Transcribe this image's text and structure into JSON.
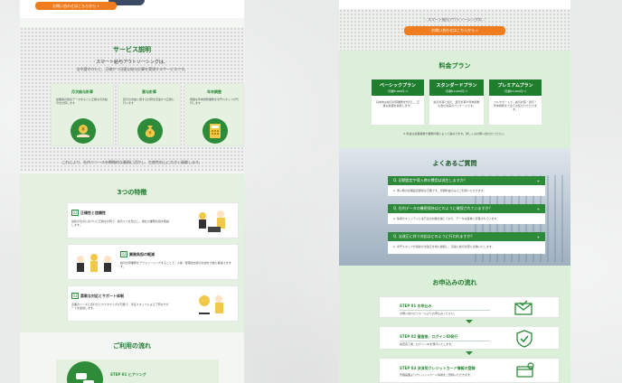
{
  "left": {
    "cta_label": "お問い合わせはこちらから »",
    "service": {
      "title": "サービス説明",
      "lead1": "スマート給与アウトソーシングは、",
      "lead2": "法令遵守のもと、正確かつ迅速な給与計算を実現するサービスです。",
      "cards": [
        {
          "title": "月次給与計算",
          "text": "従業員の勤怠データをもとに正確な月次給与を計算します"
        },
        {
          "title": "賞与計算",
          "text": "賞与の支給に関する計算を迅速かつ正確に行います"
        },
        {
          "title": "年末調整",
          "text": "煩雑な年末調整業務を専門スタッフが代行します"
        }
      ],
      "note": "これにより、社内リソースを戦略的な業務に活かし、生産性向上に大きく貢献します。"
    },
    "features": {
      "title": "3つの特徴",
      "items": [
        {
          "num": "01",
          "title": "正確性と信頼性",
          "text": "最新の法令に基づいた正確な計算で、給与ミスを防止し、貴社の業務負担を軽減します。"
        },
        {
          "num": "02",
          "title": "業務負担の軽減",
          "text": "給与計算業務をアウトソーシングすることで、人事・経理担当者の負担を大幅に軽減できます。"
        },
        {
          "num": "03",
          "title": "柔軟な対応とサポート体制",
          "text": "企業のニーズに合わせたカスタマイズが可能で、専任スタッフによる丁寧なサポートを提供します。"
        }
      ]
    },
    "flow": {
      "title": "ご利用の流れ",
      "step1": "STEP 01  ヒアリング"
    }
  },
  "right": {
    "cta_caption": "＼ スマート給与アウトソーシングの ／",
    "cta_label": "お問い合わせはこちらから »",
    "pricing": {
      "title": "料金プラン",
      "plans": [
        {
          "name": "ベーシックプラン",
          "price": "（月額5,000円〜）",
          "text": "基本的な給与計算業務を代行し、正確な処理を提供します。"
        },
        {
          "name": "スタンダードプラン",
          "price": "（月額10,000円〜）",
          "text": "給与計算に加え、賞与計算や年末調整も含む充実のパッケージです。"
        },
        {
          "name": "プレミアムプラン",
          "price": "（月額15,000円〜）",
          "text": "フルサポートで、給与計算・賞与・年末調整まで全てお任せいただけます。"
        }
      ],
      "note": "※ 料金は従業員数や業務内容によって異なります。詳しくはお問い合わせください。"
    },
    "faq": {
      "title": "よくあるご質問",
      "items": [
        {
          "q": "Q.  初期設定や導入時の費用は発生しますか？",
          "a": "A.  導入時の初期設定費用は不要です。月額料金のみでご利用いただけます。"
        },
        {
          "q": "Q.  社内データの機密保持はどのように確保されていますか？",
          "a": "A.  情報セキュリティには万全の対策を講じており、データは厳重に管理されています。"
        },
        {
          "q": "Q.  法改正に伴う対応はどのように行われますか？",
          "a": "A.  専門スタッフが最新の法改正を常に確認し、迅速に給与計算に反映いたします。"
        }
      ]
    },
    "apply": {
      "title": "お申込みの流れ",
      "steps": [
        {
          "title": "STEP 01  お申込み",
          "text": "お問い合わせフォームよりお申込みください。"
        },
        {
          "title": "STEP 02  審査後、ログインID発行",
          "text": "審査完了後、ログインIDを発行いたします。"
        },
        {
          "title": "STEP 03  決済用クレジットカード情報の登録",
          "text": "管理画面よりクレジットカード情報をご登録いただきます。"
        }
      ]
    }
  },
  "colors": {
    "green": "#1e7e2e",
    "orange": "#ef7d1f",
    "light_green": "#dcefd9"
  }
}
